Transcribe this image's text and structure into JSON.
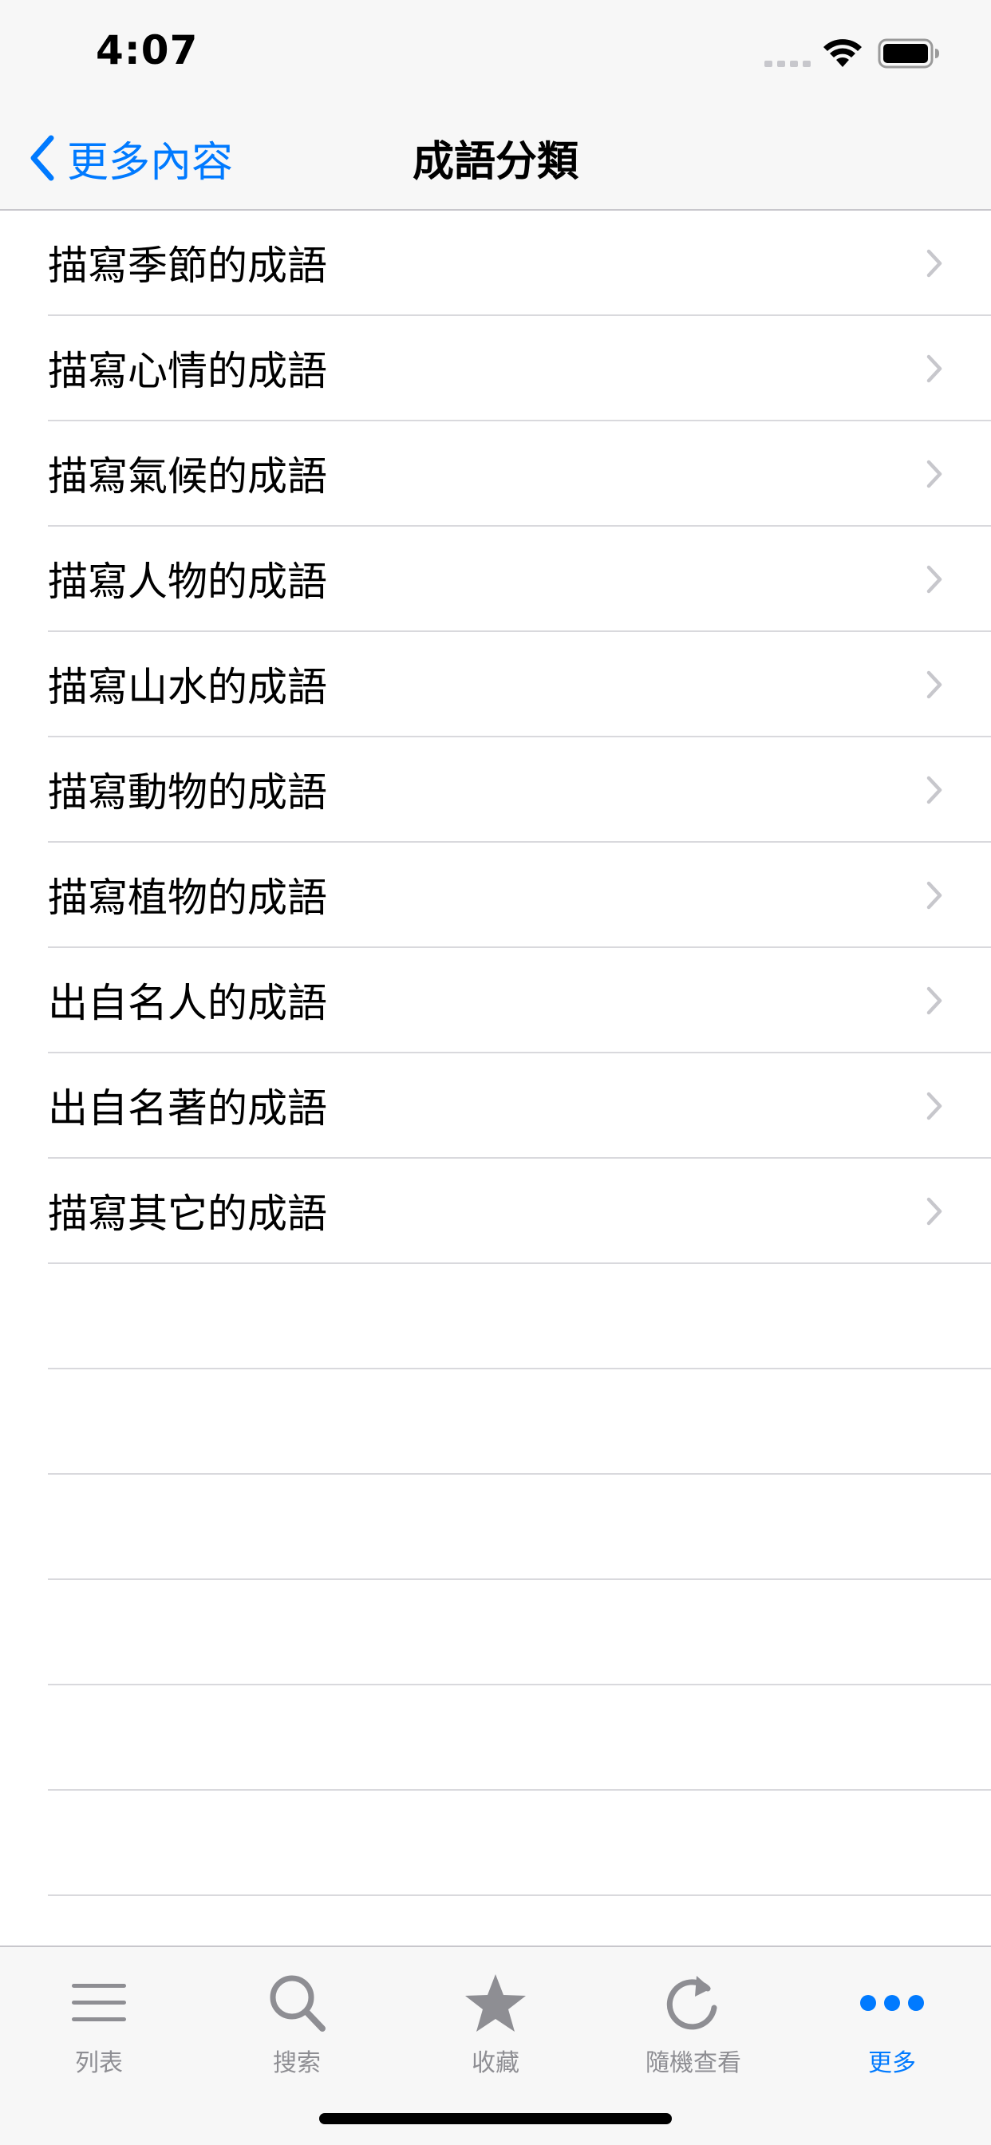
{
  "status_bar": {
    "time": "4:07"
  },
  "nav": {
    "back_label": "更多內容",
    "title": "成語分類"
  },
  "list": {
    "items": [
      {
        "label": "描寫季節的成語"
      },
      {
        "label": "描寫心情的成語"
      },
      {
        "label": "描寫氣候的成語"
      },
      {
        "label": "描寫人物的成語"
      },
      {
        "label": "描寫山水的成語"
      },
      {
        "label": "描寫動物的成語"
      },
      {
        "label": "描寫植物的成語"
      },
      {
        "label": "出自名人的成語"
      },
      {
        "label": "出自名著的成語"
      },
      {
        "label": "描寫其它的成語"
      }
    ],
    "empty_rows": 6
  },
  "tab_bar": {
    "tabs": [
      {
        "label": "列表",
        "icon": "list-icon"
      },
      {
        "label": "搜索",
        "icon": "search-icon"
      },
      {
        "label": "收藏",
        "icon": "star-icon"
      },
      {
        "label": "隨機查看",
        "icon": "refresh-icon"
      },
      {
        "label": "更多",
        "icon": "more-icon"
      }
    ],
    "active_index": 4
  },
  "colors": {
    "accent": "#007aff",
    "inactive": "#8e8e93",
    "separator": "#d9d9dd",
    "bar_background": "#f7f7f7",
    "chevron": "#c7c7cc"
  }
}
